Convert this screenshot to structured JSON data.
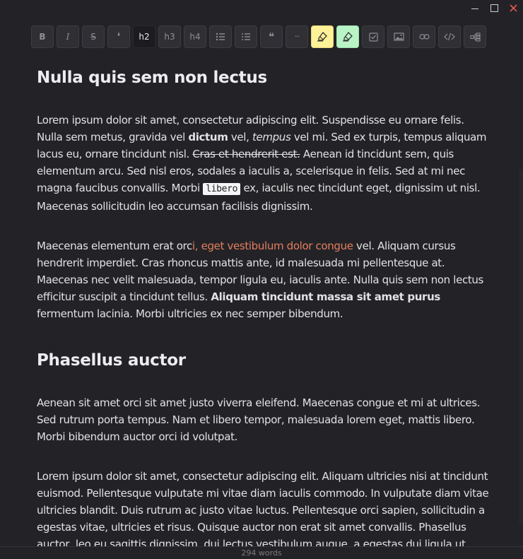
{
  "window": {
    "controls": [
      "minimize",
      "maximize",
      "close"
    ],
    "close_color": "#ff5c5c"
  },
  "toolbar": {
    "buttons": [
      {
        "name": "bold",
        "label": "B"
      },
      {
        "name": "italic",
        "label": "I"
      },
      {
        "name": "strikethrough",
        "label": "S"
      },
      {
        "name": "inline-code",
        "label": "❛"
      },
      {
        "name": "heading-2",
        "label": "h2",
        "active": true
      },
      {
        "name": "heading-3",
        "label": "h3"
      },
      {
        "name": "heading-4",
        "label": "h4"
      },
      {
        "name": "bullet-list",
        "icon": "bullet-list-icon"
      },
      {
        "name": "ordered-list",
        "icon": "ordered-list-icon"
      },
      {
        "name": "blockquote",
        "label": "❝"
      },
      {
        "name": "horizontal-rule",
        "label": "···"
      },
      {
        "name": "highlight-yellow",
        "icon": "highlighter-icon",
        "color": "#fff197"
      },
      {
        "name": "highlight-green",
        "icon": "highlighter-icon",
        "color": "#b8f4c6"
      },
      {
        "name": "checklist",
        "icon": "checkbox-icon"
      },
      {
        "name": "image",
        "icon": "image-icon"
      },
      {
        "name": "link",
        "icon": "link-icon"
      },
      {
        "name": "code-block",
        "icon": "code-icon"
      },
      {
        "name": "outline",
        "icon": "tree-icon"
      }
    ]
  },
  "document": {
    "h1": "Nulla quis sem non lectus",
    "p1": {
      "a": "Lorem ipsum dolor sit amet, consectetur adipiscing elit. Suspendisse eu ornare felis. Nulla sem metus, gravida vel ",
      "bold": "dictum",
      "b": " vel, ",
      "italic": "tempus",
      "c": " vel mi. Sed ex turpis, tempus aliquam lacus eu, ornare tincidunt nisl. ",
      "strike": "Cras et hendrerit est.",
      "d": " Aenean id tincidunt sem, quis elementum arcu. Sed nisl eros, sodales a iaculis a, scelerisque in felis. Sed at mi nec magna faucibus convallis. Morbi ",
      "code": "libero",
      "e": " ex, iaculis nec tincidunt eget, dignissim ut nisl. Maecenas sollicitudin leo accumsan facilisis dignissim."
    },
    "p2": {
      "a": "Maecenas elementum erat orc",
      "link": "i, eget vestibulum dolor congue",
      "b": " vel. Aliquam cursus hendrerit imperdiet. Cras rhoncus mattis ante, id malesuada mi pellentesque at. Maecenas nec velit malesuada, tempor ligula eu, iaculis ante. Nulla quis sem non lectus efficitur suscipit a tincidunt tellus. ",
      "bold": "Aliquam tincidunt massa sit amet purus",
      "c": " fermentum lacinia. Morbi ultricies ex nec semper bibendum."
    },
    "h2": "Phasellus auctor",
    "p3": "Aenean sit amet orci sit amet justo viverra eleifend. Maecenas congue et mi at ultrices. Sed rutrum porta tempus. Nam et libero tempor, malesuada lorem eget, mattis libero. Morbi bibendum auctor orci id volutpat.",
    "p4": "Lorem ipsum dolor sit amet, consectetur adipiscing elit. Aliquam ultricies nisi at tincidunt euismod. Pellentesque vulputate mi vitae diam iaculis commodo. In vulputate diam vitae ultricies blandit. Duis rutrum ac justo vitae luctus. Pellentesque orci sapien, sollicitudin a egestas vitae, ultricies et risus. Quisque auctor non erat sit amet convallis. Phasellus auctor, leo eu sagittis dignissim, dui lectus vestibulum augue, a egestas dui ligula ut"
  },
  "status": {
    "word_count": "294 words"
  }
}
